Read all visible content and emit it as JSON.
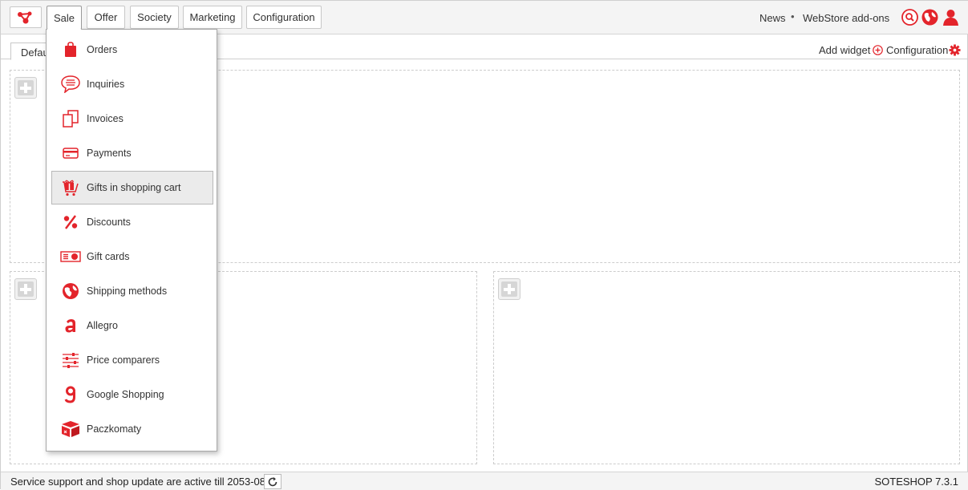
{
  "topbar": {
    "nav": [
      {
        "label": "Sale"
      },
      {
        "label": "Offer"
      },
      {
        "label": "Society"
      },
      {
        "label": "Marketing"
      },
      {
        "label": "Configuration"
      }
    ],
    "news": "News",
    "separator": "•",
    "addons": "WebStore add-ons",
    "icons": [
      "search-icon",
      "globe-icon",
      "user-icon"
    ]
  },
  "toolbar": {
    "dashboard_tab": "Default",
    "add_widget": "Add widget",
    "configuration": "Configuration"
  },
  "sale_menu": {
    "items": [
      {
        "label": "Orders",
        "icon": "shopping-bag-icon"
      },
      {
        "label": "Inquiries",
        "icon": "speech-bubble-icon"
      },
      {
        "label": "Invoices",
        "icon": "documents-icon"
      },
      {
        "label": "Payments",
        "icon": "credit-card-icon"
      },
      {
        "label": "Gifts in shopping cart",
        "icon": "gift-cart-icon"
      },
      {
        "label": "Discounts",
        "icon": "percent-icon"
      },
      {
        "label": "Gift cards",
        "icon": "gift-card-icon"
      },
      {
        "label": "Shipping methods",
        "icon": "globe-shipping-icon"
      },
      {
        "label": "Allegro",
        "icon": "allegro-icon"
      },
      {
        "label": "Price comparers",
        "icon": "sliders-icon"
      },
      {
        "label": "Google Shopping",
        "icon": "google-shopping-icon"
      },
      {
        "label": "Paczkomaty",
        "icon": "parcel-locker-icon"
      }
    ],
    "highlighted": "Gifts in shopping cart"
  },
  "footer": {
    "support": "Service support and shop update are active till 2053-08-26",
    "version": "SOTESHOP 7.3.1"
  },
  "colors": {
    "accent": "#e3242b",
    "topbar_bg": "#f4f4f4",
    "highlight_bg": "#ebebeb"
  }
}
